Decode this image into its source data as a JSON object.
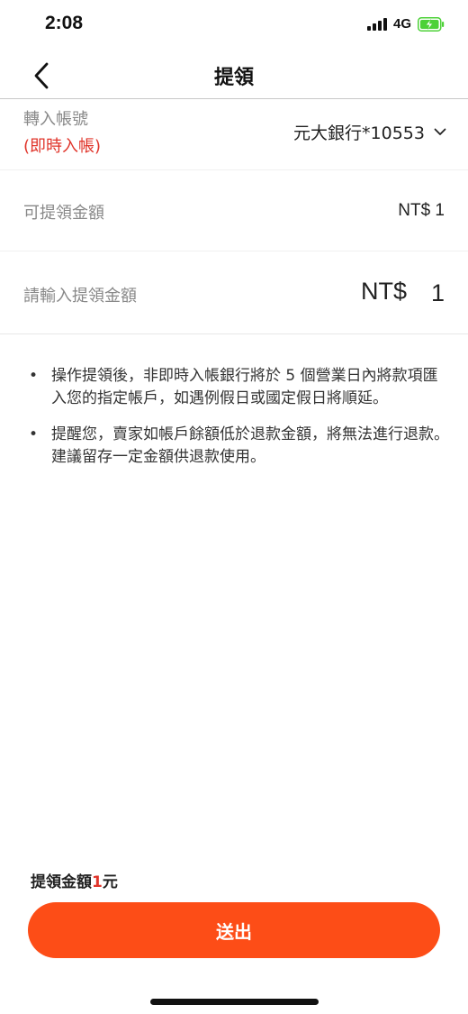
{
  "status_bar": {
    "time": "2:08",
    "network": "4G",
    "battery_icon": "battery-charging-icon",
    "battery_color": "#4cd137"
  },
  "nav": {
    "title": "提領",
    "back_icon": "chevron-left-icon"
  },
  "account": {
    "label": "轉入帳號",
    "sub_label": "(即時入帳)",
    "value": "元大銀行*10553",
    "dropdown_icon": "chevron-down-icon"
  },
  "available": {
    "label": "可提領金額",
    "value": "NT$ 1"
  },
  "withdraw_input": {
    "label": "請輸入提領金額",
    "currency": "NT$",
    "value": "1"
  },
  "notes": [
    "操作提領後，非即時入帳銀行將於 5 個營業日內將款項匯入您的指定帳戶，如遇例假日或國定假日將順延。",
    "提醒您，賣家如帳戶餘額低於退款金額，將無法進行退款。建議留存一定金額供退款使用。"
  ],
  "summary": {
    "prefix": "提領金額",
    "amount": "1",
    "suffix": "元"
  },
  "submit": {
    "label": "送出"
  },
  "colors": {
    "accent": "#fd4d17",
    "highlight_red": "#e0342a"
  }
}
